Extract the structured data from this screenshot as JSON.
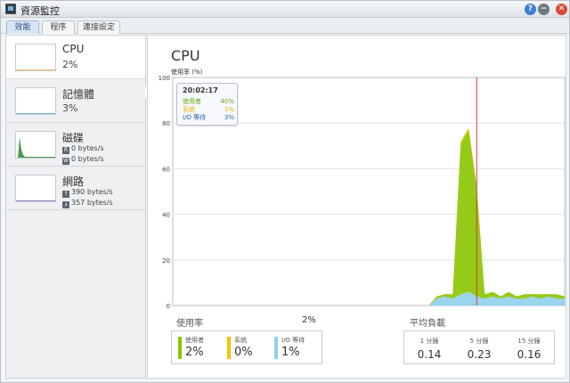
{
  "window": {
    "title": "資源監控",
    "controls": {
      "help": "?",
      "minimize": "−",
      "close": "✕"
    }
  },
  "tabs": [
    {
      "label": "效能",
      "active": true
    },
    {
      "label": "程序",
      "active": false
    },
    {
      "label": "連接設定",
      "active": false
    }
  ],
  "sidebar": {
    "items": [
      {
        "name": "CPU",
        "value": "2%",
        "color": "#f0a030",
        "icon": "cpu-thumbnail"
      },
      {
        "name": "記憶體",
        "value": "3%",
        "color": "#3d98c8",
        "icon": "memory-thumbnail"
      },
      {
        "name": "磁碟",
        "read": "0 bytes/s",
        "write": "0 bytes/s",
        "read_icon": "R",
        "write_icon": "W",
        "color": "#3a8a3a",
        "icon": "disk-thumbnail"
      },
      {
        "name": "網路",
        "upload": "390 bytes/s",
        "download": "357 bytes/s",
        "upload_icon": "↑",
        "download_icon": "↓",
        "color": "#7a52b8",
        "icon": "network-thumbnail"
      }
    ]
  },
  "main": {
    "title": "CPU",
    "ylabel": "使用率 (%)",
    "tooltip": {
      "time": "20:02:17",
      "rows": [
        {
          "label": "使用者",
          "value": "40%",
          "color": "#6aa718"
        },
        {
          "label": "系統",
          "value": "1%",
          "color": "#e8b400"
        },
        {
          "label": "I/O 等待",
          "value": "3%",
          "color": "#2a63b8"
        }
      ]
    },
    "usage": {
      "label": "使用率",
      "total": "2%",
      "metrics": [
        {
          "name": "使用者",
          "value": "2%",
          "color": "#8bc400"
        },
        {
          "name": "系統",
          "value": "0%",
          "color": "#f2c500"
        },
        {
          "name": "I/O 等待",
          "value": "1%",
          "color": "#8fd0ee"
        }
      ]
    },
    "load": {
      "label": "平均負載",
      "items": [
        {
          "name": "1 分鐘",
          "value": "0.14"
        },
        {
          "name": "5 分鐘",
          "value": "0.23"
        },
        {
          "name": "15 分鐘",
          "value": "0.16"
        }
      ]
    }
  },
  "chart_data": {
    "type": "area",
    "ylim": [
      0,
      100
    ],
    "yticks": [
      "0",
      "20",
      "40",
      "60",
      "80",
      "100"
    ],
    "grid": true,
    "cursor_index": 38,
    "x_count": 50,
    "series": [
      {
        "name": "使用者",
        "color": "#8bc400",
        "values": [
          0,
          0,
          0,
          0,
          0,
          0,
          0,
          0,
          0,
          0,
          0,
          0,
          0,
          0,
          0,
          0,
          0,
          0,
          0,
          0,
          0,
          0,
          0,
          0,
          0,
          0,
          0,
          0,
          0,
          0,
          0,
          0,
          0,
          1,
          1,
          2,
          66,
          71,
          48,
          2,
          2,
          1,
          2,
          1,
          2,
          1,
          2,
          1,
          2,
          1
        ]
      },
      {
        "name": "系統",
        "color": "#f2c500",
        "values": [
          0,
          0,
          0,
          0,
          0,
          0,
          0,
          0,
          0,
          0,
          0,
          0,
          0,
          0,
          0,
          0,
          0,
          0,
          0,
          0,
          0,
          0,
          0,
          0,
          0,
          0,
          0,
          0,
          0,
          0,
          0,
          0,
          0,
          0,
          0,
          0,
          1,
          1,
          1,
          0,
          0,
          0,
          0,
          0,
          0,
          0,
          0,
          0,
          0,
          0
        ]
      },
      {
        "name": "I/O 等待",
        "color": "#8fd0ee",
        "values": [
          0,
          0,
          0,
          0,
          0,
          0,
          0,
          0,
          0,
          0,
          0,
          0,
          0,
          0,
          0,
          0,
          0,
          0,
          0,
          0,
          0,
          0,
          0,
          0,
          0,
          0,
          0,
          0,
          0,
          0,
          0,
          0,
          0,
          3,
          4,
          3,
          5,
          6,
          4,
          3,
          4,
          3,
          4,
          3,
          3,
          4,
          3,
          4,
          3,
          3
        ]
      }
    ]
  }
}
